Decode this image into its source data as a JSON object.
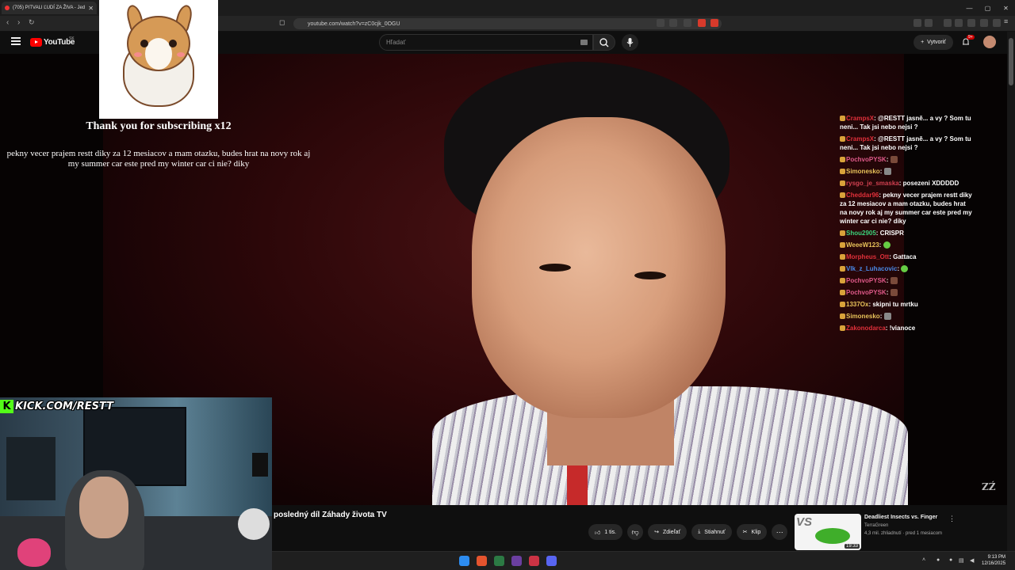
{
  "browser": {
    "tab_title": "(705) PITVALI ĽUDÍ ZA ŽIVA - Jed",
    "url": "youtube.com/watch?v=zC0cjk_0OGU"
  },
  "youtube": {
    "logo_text": "YouTube",
    "region": "SK",
    "search_placeholder": "Hľadať",
    "create_label": "Vytvoriť",
    "notifications_badge": "9+"
  },
  "overlay": {
    "sub_alert_title": "Thank you for subscribing x12",
    "sub_alert_message": "pekny vecer prajem restt diky za 12 mesiacov a mam otazku, budes hrat na novy rok aj my summer car este pred my winter car ci nie? diky",
    "kick_url": "KICK.COM/RESTT",
    "watermark": "ZŹ"
  },
  "chat": [
    {
      "user": "CrampsX",
      "color": "#e0303a",
      "text": "@RESTT jasně... a vy ? Som tu neni... Tak jsi nebo nejsi ?"
    },
    {
      "user": "CrampsX",
      "color": "#e0303a",
      "text": "@RESTT jasně... a vy ? Som tu neni... Tak jsi nebo nejsi ?"
    },
    {
      "user": "PochvoPYSK",
      "color": "#e05a8a",
      "text": "",
      "emote": "brown"
    },
    {
      "user": "Simonesko",
      "color": "#e8c25a",
      "text": "",
      "emote": "gray"
    },
    {
      "user": "rysgo_je_smaska",
      "color": "#d04050",
      "text": "posezeni XDDDDD"
    },
    {
      "user": "Cheddar96",
      "color": "#e0303a",
      "text": "pekny vecer prajem restt diky za 12 mesiacov a mam otazku, budes hrat na novy rok aj my summer car este pred my winter car ci nie? diky"
    },
    {
      "user": "Shou2905",
      "color": "#3bd17a",
      "text": "CRISPR"
    },
    {
      "user": "WeeeW123",
      "color": "#e8c25a",
      "text": "",
      "emote": "green"
    },
    {
      "user": "Morpheus_Ott",
      "color": "#e0303a",
      "text": "Gattaca"
    },
    {
      "user": "Vlk_z_Luhacovic",
      "color": "#4a8ae8",
      "text": "",
      "emote": "green"
    },
    {
      "user": "PochvoPYSK",
      "color": "#e05a8a",
      "text": "",
      "emote": "brown"
    },
    {
      "user": "PochvoPYSK",
      "color": "#e05a8a",
      "text": "",
      "emote": "brown"
    },
    {
      "user": "1337Ox",
      "color": "#e8c25a",
      "text": "skipni tu mrtku"
    },
    {
      "user": "Simonesko",
      "color": "#e8c25a",
      "text": "",
      "emote": "gray"
    },
    {
      "user": "Zakonodarca",
      "color": "#e0303a",
      "text": "!vianoce"
    }
  ],
  "video": {
    "title": "posledný díl Záhady života TV",
    "like_count": "1 tis.",
    "share_label": "Zdieľať",
    "download_label": "Stiahnuť",
    "clip_label": "Klip"
  },
  "recommended": {
    "title": "Deadliest Insects vs. Finger",
    "channel": "TerraGreen",
    "meta": "4,3 mil. zhliadnutí · pred 1 mesiacom",
    "duration": "19:33",
    "thumb_text": "VS"
  },
  "taskbar": {
    "time": "9:13 PM",
    "date": "12/16/2025"
  }
}
